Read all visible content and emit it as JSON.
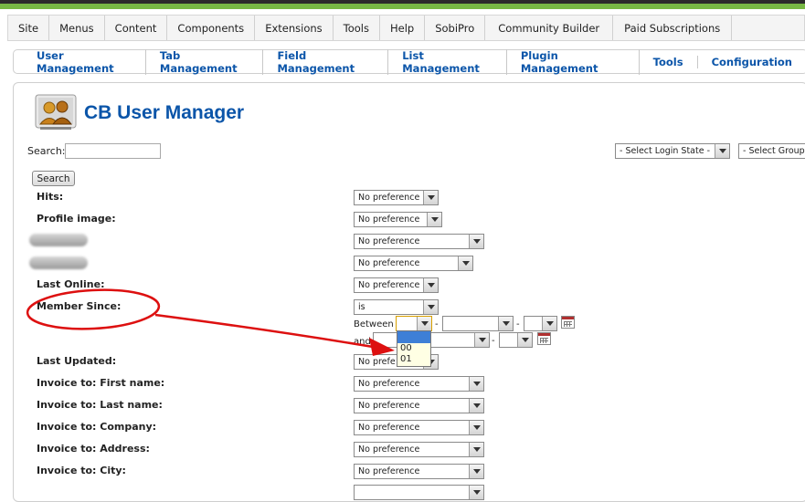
{
  "main_menu": [
    "Site",
    "Menus",
    "Content",
    "Components",
    "Extensions",
    "Tools",
    "Help",
    "SobiPro",
    "Community Builder",
    "Paid Subscriptions"
  ],
  "sub_menu": [
    "User Management",
    "Tab Management",
    "Field Management",
    "List Management",
    "Plugin Management",
    "Tools",
    "Configuration"
  ],
  "page": {
    "title": "CB User Manager",
    "icon": "users-icon"
  },
  "search": {
    "label": "Search:",
    "value": "",
    "button": "Search"
  },
  "filters": {
    "login_state": "- Select Login State -",
    "group": "- Select Group"
  },
  "fields": [
    {
      "label": "Hits:",
      "select": "No preference"
    },
    {
      "label": "Profile image:",
      "select": "No preference"
    },
    {
      "label": "",
      "select": "No preference"
    },
    {
      "label": "",
      "select": "No preference"
    },
    {
      "label": "Last Online:",
      "select": "No preference"
    },
    {
      "label": "Member Since:",
      "select": "is"
    },
    {
      "label": "Last Updated:",
      "select": "No prefe"
    },
    {
      "label": "Invoice to: First name:",
      "select": "No preference"
    },
    {
      "label": "Invoice to: Last name:",
      "select": "No preference"
    },
    {
      "label": "Invoice to: Company:",
      "select": "No preference"
    },
    {
      "label": "Invoice to: Address:",
      "select": "No preference"
    },
    {
      "label": "Invoice to: City:",
      "select": "No preference"
    }
  ],
  "member_since": {
    "between": "Between",
    "and": "and"
  },
  "dropdown_options": [
    "00",
    "01"
  ],
  "colors": {
    "accent": "#0b55a9",
    "topbar_green": "#77b844",
    "annotation_red": "#dd1010",
    "dropdown_bg": "#ffffe4",
    "highlight": "#3e7fd6"
  }
}
